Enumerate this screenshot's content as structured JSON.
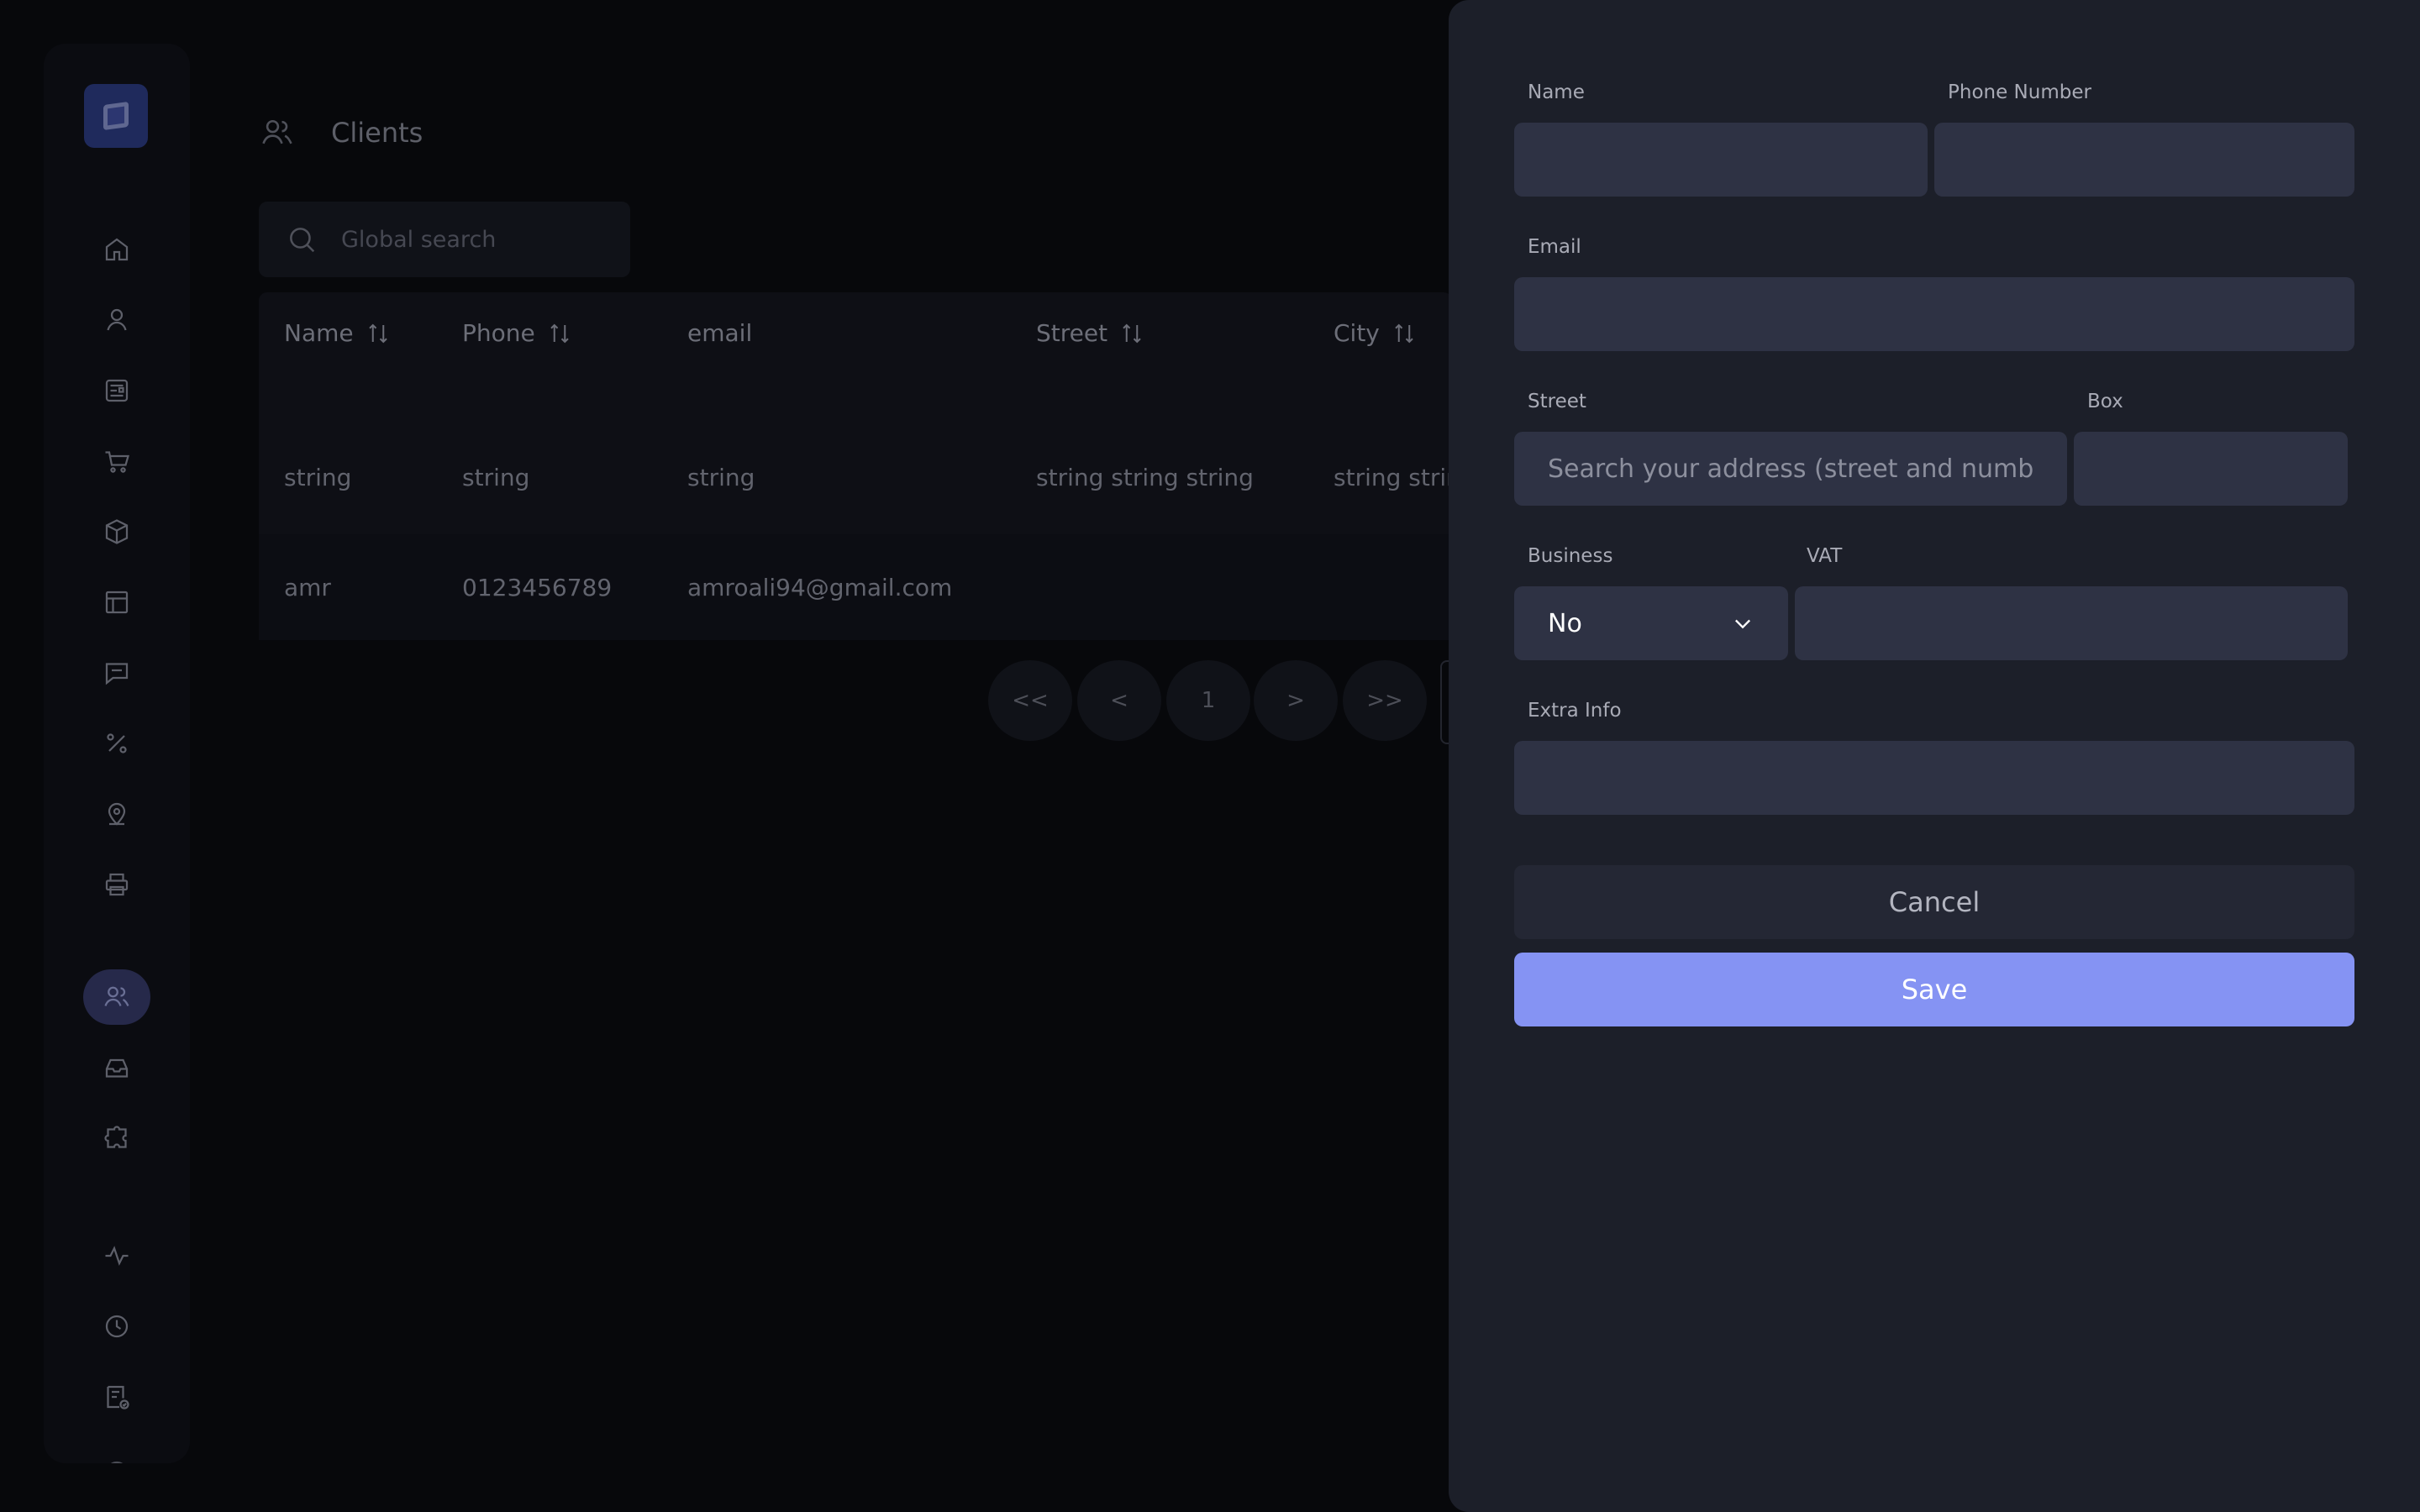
{
  "sidebar": {
    "items": [
      {
        "icon": "home-icon",
        "label": "home"
      },
      {
        "icon": "user-icon",
        "label": "user"
      },
      {
        "icon": "document-icon",
        "label": "document"
      },
      {
        "icon": "cart-icon",
        "label": "cart"
      },
      {
        "icon": "box-icon",
        "label": "box"
      },
      {
        "icon": "layout-icon",
        "label": "layout"
      },
      {
        "icon": "message-icon",
        "label": "message"
      },
      {
        "icon": "percent-icon",
        "label": "percent"
      },
      {
        "icon": "location-icon",
        "label": "location"
      },
      {
        "icon": "printer-icon",
        "label": "printer"
      },
      {
        "icon": "users-icon",
        "label": "users",
        "active": true
      },
      {
        "icon": "inbox-icon",
        "label": "inbox"
      },
      {
        "icon": "puzzle-icon",
        "label": "puzzle"
      },
      {
        "icon": "activity-icon",
        "label": "activity"
      },
      {
        "icon": "clock-icon",
        "label": "clock"
      },
      {
        "icon": "checklist-icon",
        "label": "checklist"
      }
    ]
  },
  "header": {
    "title": "Clients"
  },
  "search": {
    "placeholder": "Global search"
  },
  "table": {
    "columns": [
      "Name",
      "Phone",
      "email",
      "Street",
      "City"
    ],
    "rows": [
      [
        "string",
        "string",
        "string",
        "string string string",
        "string strin"
      ],
      [
        "amr",
        "0123456789",
        "amroali94@gmail.com",
        "",
        ""
      ]
    ]
  },
  "pagination": {
    "first": "<<",
    "prev": "<",
    "current": "1",
    "next": ">",
    "last": ">>"
  },
  "form": {
    "name_label": "Name",
    "phone_label": "Phone Number",
    "email_label": "Email",
    "street_label": "Street",
    "street_placeholder": "Search your address (street and number)",
    "box_label": "Box",
    "business_label": "Business",
    "business_value": "No",
    "vat_label": "VAT",
    "extra_label": "Extra Info",
    "cancel_label": "Cancel",
    "save_label": "Save"
  },
  "colors": {
    "accent": "#8593f3",
    "panel": "#1c1f29",
    "field": "#2e3244"
  }
}
